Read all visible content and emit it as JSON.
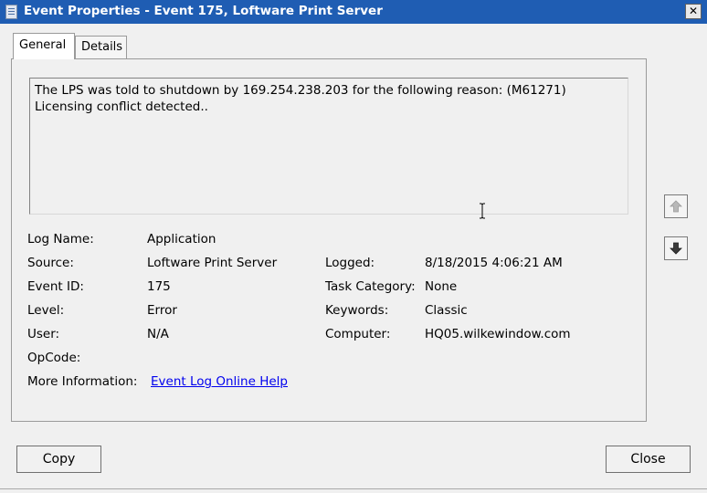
{
  "window": {
    "title": "Event Properties - Event 175, Loftware Print Server",
    "close_glyph": "✕"
  },
  "tabs": [
    {
      "label": "General",
      "active": true
    },
    {
      "label": "Details",
      "active": false
    }
  ],
  "description": "The LPS was told to shutdown by 169.254.238.203 for the following reason: (M61271) Licensing conflict detected..",
  "fields": {
    "log_name": {
      "label": "Log Name:",
      "value": "Application"
    },
    "source": {
      "label": "Source:",
      "value": "Loftware Print Server"
    },
    "event_id": {
      "label": "Event ID:",
      "value": "175"
    },
    "level": {
      "label": "Level:",
      "value": "Error"
    },
    "user": {
      "label": "User:",
      "value": "N/A"
    },
    "opcode": {
      "label": "OpCode:",
      "value": ""
    },
    "more_info": {
      "label": "More Information:",
      "link": "Event Log Online Help"
    },
    "logged": {
      "label": "Logged:",
      "value": "8/18/2015 4:06:21 AM"
    },
    "task_category": {
      "label": "Task Category:",
      "value": "None"
    },
    "keywords": {
      "label": "Keywords:",
      "value": "Classic"
    },
    "computer": {
      "label": "Computer:",
      "value": "HQ05.wilkewindow.com"
    }
  },
  "buttons": {
    "copy": "Copy",
    "close": "Close"
  },
  "icons": {
    "nav_up": "arrow-up-icon",
    "nav_down": "arrow-down-icon",
    "text_cursor": "i-beam-cursor-icon"
  },
  "colors": {
    "titlebar": "#1f5db3",
    "link": "#0000ee",
    "background": "#f0f0f0"
  }
}
